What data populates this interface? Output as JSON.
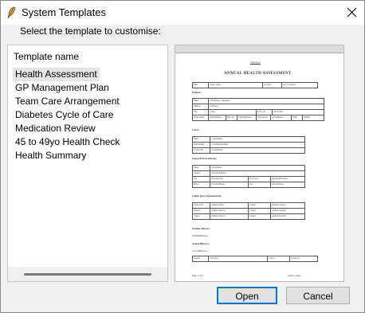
{
  "window": {
    "title": "System Templates"
  },
  "prompt": "Select the template to customise:",
  "list": {
    "header": "Template name",
    "items": [
      "Health Assessment",
      "GP Management Plan",
      "Team Care Arrangement",
      "Diabetes Cycle of Care",
      "Medication Review",
      "45 to 49yo Health Check",
      "Health Summary"
    ],
    "selected_index": 0
  },
  "preview": {
    "header_link": "«Practice»",
    "title": "ANNUAL HEALTH ASSESSMENT",
    "date_row": [
      "Date",
      "«Date_today»",
      "Location",
      "«At_Location»"
    ],
    "sections": {
      "patient": "Patient",
      "carer": "Carer",
      "gp": "General Practitioner",
      "other_gp": "Other gust organisations",
      "family_history": "Family History",
      "social_history": "Social History"
    },
    "patient_rows": [
      [
        "Name",
        "«FirstName» «Surname»"
      ],
      [
        "Address",
        "«Address»"
      ],
      [
        "City",
        "«City»",
        "Post code",
        "«PostCode»"
      ],
      [
        "Home phone",
        "«HomePhone»",
        "Mob. No",
        "«MobilePhone»",
        "Work phone",
        "«WorkPhone»",
        "DOB",
        "«DOB»"
      ]
    ],
    "carer_rows": [
      [
        "Name",
        "«CarerName»"
      ],
      [
        "Relationship",
        "«CarerRelationship»"
      ],
      [
        "Contact Ph",
        "«CarerPhone»"
      ]
    ],
    "gp_rows": [
      [
        "Name",
        "«UserName»"
      ],
      [
        "Address",
        "«PracticeAddress»"
      ],
      [
        "City",
        "«PracticeCity»",
        "Post Code",
        "«PracticePostcode»"
      ],
      [
        "Phone",
        "«PracticePhone»",
        "Fax",
        "«PracticeFax»"
      ]
    ],
    "other_rows": [
      [
        "Contact Ph",
        "«OtherContact»",
        "Contact",
        "«OtherContact2»"
      ],
      [
        "Contact",
        "«OtherContact3»",
        "Contact",
        "«OtherContact4»"
      ],
      [
        "Contact",
        "«OtherContact5»",
        "Contact",
        "«OtherContact6»"
      ]
    ],
    "family_text": "«FamilyHistory»",
    "social_text": "«SocialHistory»",
    "alcohol_row": [
      "Alcohol",
      "«Alcohol»",
      "Tobacco",
      "«Tobacco»"
    ],
    "footer_left": "Page 1 of 6",
    "footer_right": "«Date_today»"
  },
  "buttons": {
    "open": "Open",
    "cancel": "Cancel"
  }
}
